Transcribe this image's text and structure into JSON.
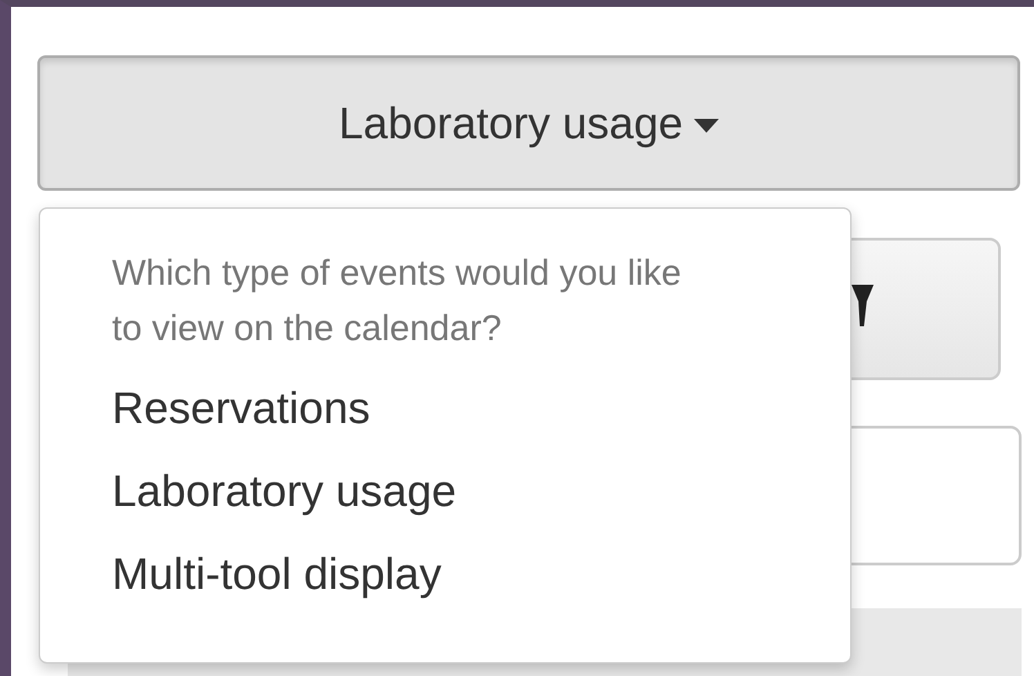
{
  "event_type_button": {
    "label": "Laboratory usage",
    "expanded": true
  },
  "event_type_menu": {
    "header": "Which type of events would you like to view on the calendar?",
    "items": [
      {
        "label": "Reservations"
      },
      {
        "label": "Laboratory usage"
      },
      {
        "label": "Multi-tool display"
      }
    ]
  }
}
